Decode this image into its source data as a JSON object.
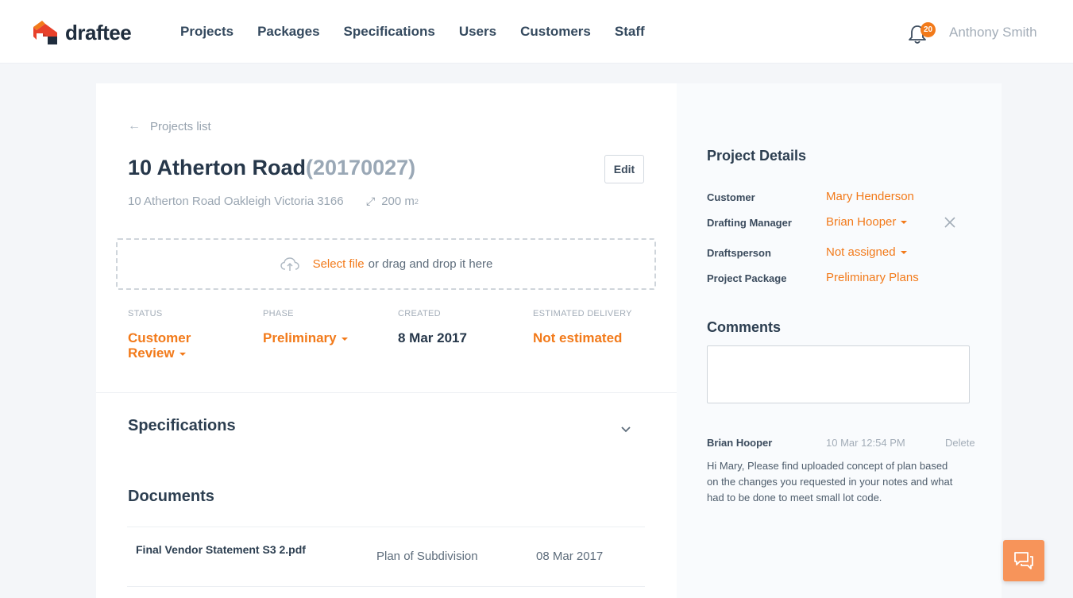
{
  "app": {
    "brand": "draftee"
  },
  "nav": {
    "items": [
      "Projects",
      "Packages",
      "Specifications",
      "Users",
      "Customers",
      "Staff"
    ]
  },
  "header": {
    "notifications_count": "20",
    "user_name": "Anthony Smith"
  },
  "project": {
    "back_label": "Projects list",
    "title": "10 Atherton Road",
    "id_text": "(20170027)",
    "edit_label": "Edit",
    "address": "10 Atherton Road Oakleigh Victoria 3166",
    "area_value": "200 m",
    "area_unit_sup": "2"
  },
  "upload": {
    "select_label": "Select file",
    "rest_label": "or drag and drop it here"
  },
  "meta": {
    "status_label": "STATUS",
    "status_value_line1": "Customer",
    "status_value_line2": "Review",
    "phase_label": "PHASE",
    "phase_value": "Preliminary",
    "created_label": "CREATED",
    "created_value": "8 Mar 2017",
    "delivery_label": "ESTIMATED DELIVERY",
    "delivery_value": "Not estimated"
  },
  "sections": {
    "specifications": "Specifications",
    "documents": "Documents"
  },
  "documents": [
    {
      "name": "Final Vendor Statement S3 2.pdf",
      "type": "Plan of Subdivision",
      "date": "08 Mar 2017"
    }
  ],
  "details": {
    "title": "Project Details",
    "customer_label": "Customer",
    "customer_value": "Mary Henderson",
    "manager_label": "Drafting Manager",
    "manager_value": "Brian Hooper",
    "draftsperson_label": "Draftsperson",
    "draftsperson_value": "Not assigned",
    "package_label": "Project Package",
    "package_value": "Preliminary Plans"
  },
  "comments": {
    "title": "Comments",
    "items": [
      {
        "author": "Brian Hooper",
        "time": "10 Mar 12:54 PM",
        "delete_label": "Delete",
        "body": "Hi Mary, Please find uploaded concept of plan based on the changes you requested in your notes and what had to be done to meet small lot code."
      }
    ]
  },
  "colors": {
    "accent": "#f27a1a",
    "text_dark": "#26374a",
    "muted": "#9aa6b2",
    "chat_button": "#f7945a"
  },
  "icons": [
    "logo-icon",
    "bell-icon",
    "arrow-left-icon",
    "expand-icon",
    "cloud-upload-icon",
    "chevron-down-icon",
    "close-icon",
    "chat-icon"
  ]
}
